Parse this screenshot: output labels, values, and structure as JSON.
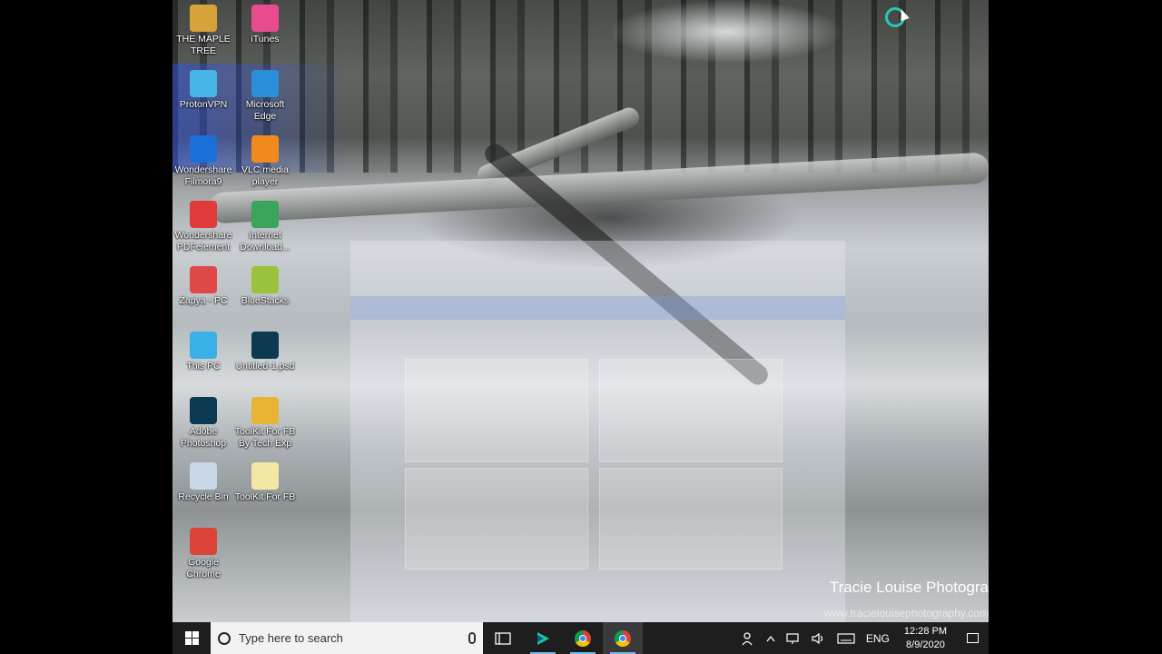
{
  "desktop": {
    "icons": [
      {
        "label": "THE MAPLE TREE",
        "name": "maple-tree-shortcut",
        "color": "#d7a23a"
      },
      {
        "label": "iTunes",
        "name": "itunes-shortcut",
        "color": "#e94b8f"
      },
      {
        "label": "ProtonVPN",
        "name": "protonvpn-shortcut",
        "color": "#47b5e6"
      },
      {
        "label": "Microsoft Edge",
        "name": "edge-shortcut",
        "color": "#2a8fd8"
      },
      {
        "label": "Wondershare Filmora9",
        "name": "filmora-shortcut",
        "color": "#1b6fd6"
      },
      {
        "label": "VLC media player",
        "name": "vlc-shortcut",
        "color": "#f08a1c"
      },
      {
        "label": "Wondershare PDFelement",
        "name": "pdfelement-shortcut",
        "color": "#e03a3a"
      },
      {
        "label": "Internet Download...",
        "name": "idm-shortcut",
        "color": "#3aa55a"
      },
      {
        "label": "Zapya - PC",
        "name": "zapya-shortcut",
        "color": "#e04848"
      },
      {
        "label": "BlueStacks",
        "name": "bluestacks-shortcut",
        "color": "#9ac23c"
      },
      {
        "label": "This PC",
        "name": "this-pc-shortcut",
        "color": "#3ab0e8"
      },
      {
        "label": "Untitled-1.psd",
        "name": "untitled-psd-shortcut",
        "color": "#0b3a52"
      },
      {
        "label": "Adobe Photoshop",
        "name": "photoshop-shortcut",
        "color": "#0b3a52"
      },
      {
        "label": "ToolKit For FB By Tech Exp",
        "name": "toolkit-fb-shortcut",
        "color": "#e8b431"
      },
      {
        "label": "Recycle Bin",
        "name": "recycle-bin-shortcut",
        "color": "#c9d8e6"
      },
      {
        "label": "ToolKit For FB",
        "name": "toolkit-fb-2-shortcut",
        "color": "#f2e7a4"
      },
      {
        "label": "Google Chrome",
        "name": "chrome-shortcut",
        "color": "#db4437"
      }
    ],
    "watermark": "Tracie Louise Photogra",
    "watermark_url": "www.tracielouisephotography.com"
  },
  "taskbar": {
    "search_placeholder": "Type here to search",
    "apps": [
      {
        "name": "task-view-button",
        "icon": "task-view-icon"
      },
      {
        "name": "filmora-taskbar-button",
        "icon": "filmora-icon"
      },
      {
        "name": "chrome-taskbar-button-1",
        "icon": "chrome-icon"
      },
      {
        "name": "chrome-taskbar-button-2",
        "icon": "chrome-icon"
      }
    ],
    "tray": {
      "language": "ENG",
      "time": "12:28 PM",
      "date": "8/9/2020"
    }
  }
}
